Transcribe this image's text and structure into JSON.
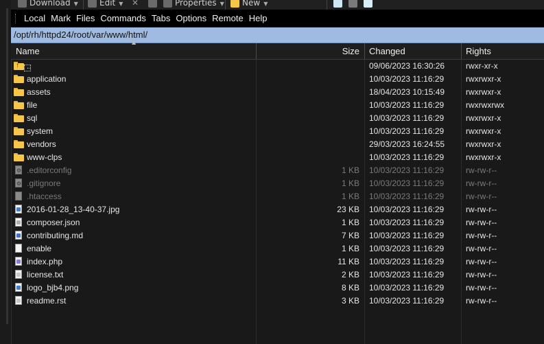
{
  "toolbar": {
    "download_label": "Download",
    "edit_label": "Edit",
    "properties_label": "Properties",
    "new_label": "New"
  },
  "menubar": {
    "items": [
      "Local",
      "Mark",
      "Files",
      "Commands",
      "Tabs",
      "Options",
      "Remote",
      "Help"
    ]
  },
  "path": "/opt/rh/httpd24/root/var/www/html/",
  "columns": {
    "name": "Name",
    "size": "Size",
    "changed": "Changed",
    "rights": "Rights"
  },
  "files": [
    {
      "name": "..",
      "size": "",
      "changed": "09/06/2023 16:30:26",
      "rights": "rwxr-xr-x",
      "icon": "parent-folder-icon"
    },
    {
      "name": "application",
      "size": "",
      "changed": "10/03/2023 11:16:29",
      "rights": "rwxrwxr-x",
      "icon": "folder-icon"
    },
    {
      "name": "assets",
      "size": "",
      "changed": "18/04/2023 10:15:49",
      "rights": "rwxrwxr-x",
      "icon": "folder-icon"
    },
    {
      "name": "file",
      "size": "",
      "changed": "10/03/2023 11:16:29",
      "rights": "rwxrwxrwx",
      "icon": "folder-icon"
    },
    {
      "name": "sql",
      "size": "",
      "changed": "10/03/2023 11:16:29",
      "rights": "rwxrwxr-x",
      "icon": "folder-icon"
    },
    {
      "name": "system",
      "size": "",
      "changed": "10/03/2023 11:16:29",
      "rights": "rwxrwxr-x",
      "icon": "folder-icon"
    },
    {
      "name": "vendors",
      "size": "",
      "changed": "29/03/2023 16:24:55",
      "rights": "rwxrwxr-x",
      "icon": "folder-icon"
    },
    {
      "name": "www-clps",
      "size": "",
      "changed": "10/03/2023 11:16:29",
      "rights": "rwxrwxr-x",
      "icon": "folder-icon"
    },
    {
      "name": ".editorconfig",
      "size": "1 KB",
      "changed": "10/03/2023 11:16:29",
      "rights": "rw-rw-r--",
      "icon": "config-file-icon",
      "hidden": true
    },
    {
      "name": ".gitignore",
      "size": "1 KB",
      "changed": "10/03/2023 11:16:29",
      "rights": "rw-rw-r--",
      "icon": "config-file-icon",
      "hidden": true
    },
    {
      "name": ".htaccess",
      "size": "1 KB",
      "changed": "10/03/2023 11:16:29",
      "rights": "rw-rw-r--",
      "icon": "file-icon",
      "hidden": true
    },
    {
      "name": "2016-01-28_13-40-37.jpg",
      "size": "23 KB",
      "changed": "10/03/2023 11:16:29",
      "rights": "rw-rw-r--",
      "icon": "image-file-icon"
    },
    {
      "name": "composer.json",
      "size": "1 KB",
      "changed": "10/03/2023 11:16:29",
      "rights": "rw-rw-r--",
      "icon": "json-file-icon"
    },
    {
      "name": "contributing.md",
      "size": "7 KB",
      "changed": "10/03/2023 11:16:29",
      "rights": "rw-rw-r--",
      "icon": "markdown-file-icon"
    },
    {
      "name": "enable",
      "size": "1 KB",
      "changed": "10/03/2023 11:16:29",
      "rights": "rw-rw-r--",
      "icon": "file-icon"
    },
    {
      "name": "index.php",
      "size": "11 KB",
      "changed": "10/03/2023 11:16:29",
      "rights": "rw-rw-r--",
      "icon": "php-file-icon"
    },
    {
      "name": "license.txt",
      "size": "2 KB",
      "changed": "10/03/2023 11:16:29",
      "rights": "rw-rw-r--",
      "icon": "text-file-icon"
    },
    {
      "name": "logo_bjb4.png",
      "size": "8 KB",
      "changed": "10/03/2023 11:16:29",
      "rights": "rw-rw-r--",
      "icon": "image-file-icon"
    },
    {
      "name": "readme.rst",
      "size": "3 KB",
      "changed": "10/03/2023 11:16:29",
      "rights": "rw-rw-r--",
      "icon": "text-file-icon"
    }
  ]
}
